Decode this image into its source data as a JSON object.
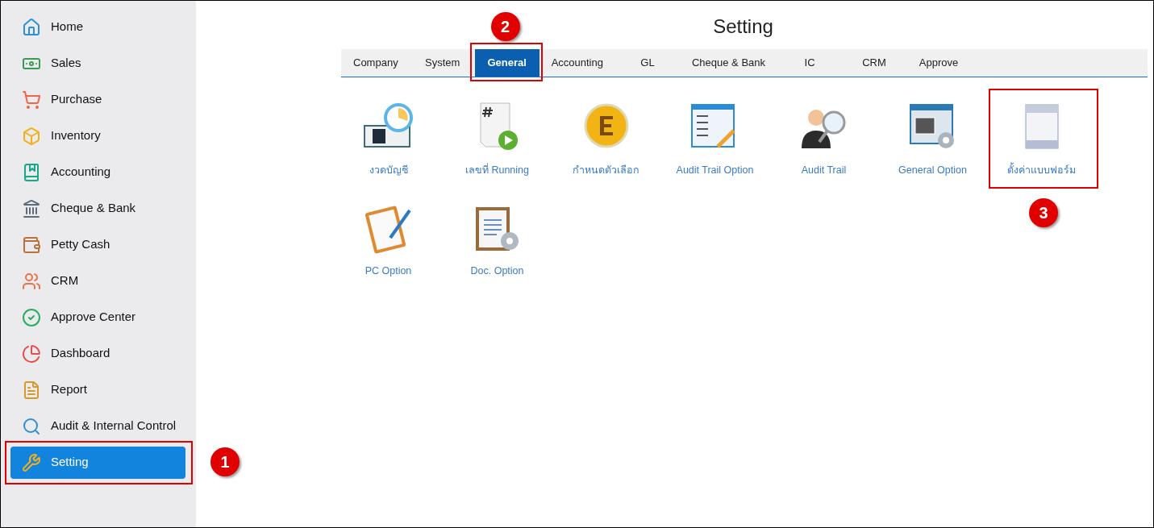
{
  "sidebar": {
    "items": [
      {
        "label": "Home",
        "selected": false
      },
      {
        "label": "Sales",
        "selected": false
      },
      {
        "label": "Purchase",
        "selected": false
      },
      {
        "label": "Inventory",
        "selected": false
      },
      {
        "label": "Accounting",
        "selected": false
      },
      {
        "label": "Cheque & Bank",
        "selected": false
      },
      {
        "label": "Petty Cash",
        "selected": false
      },
      {
        "label": "CRM",
        "selected": false
      },
      {
        "label": "Approve Center",
        "selected": false
      },
      {
        "label": "Dashboard",
        "selected": false
      },
      {
        "label": "Report",
        "selected": false
      },
      {
        "label": "Audit & Internal Control",
        "selected": false
      },
      {
        "label": "Setting",
        "selected": true,
        "callout": "1"
      }
    ]
  },
  "title": "Setting",
  "tabs": [
    {
      "label": "Company",
      "selected": false
    },
    {
      "label": "System",
      "selected": false
    },
    {
      "label": "General",
      "selected": true,
      "callout": "2"
    },
    {
      "label": "Accounting",
      "selected": false
    },
    {
      "label": "GL",
      "selected": false
    },
    {
      "label": "Cheque & Bank",
      "selected": false
    },
    {
      "label": "IC",
      "selected": false
    },
    {
      "label": "CRM",
      "selected": false
    },
    {
      "label": "Approve",
      "selected": false
    }
  ],
  "tiles": [
    {
      "label": "งวดบัญชี"
    },
    {
      "label": "เลขที่ Running"
    },
    {
      "label": "กำหนดตัวเลือก"
    },
    {
      "label": "Audit Trail Option"
    },
    {
      "label": "Audit Trail"
    },
    {
      "label": "General Option"
    },
    {
      "label": "ตั้งค่าแบบฟอร์ม",
      "callout": "3"
    },
    {
      "label": "PC Option"
    },
    {
      "label": "Doc. Option"
    }
  ]
}
